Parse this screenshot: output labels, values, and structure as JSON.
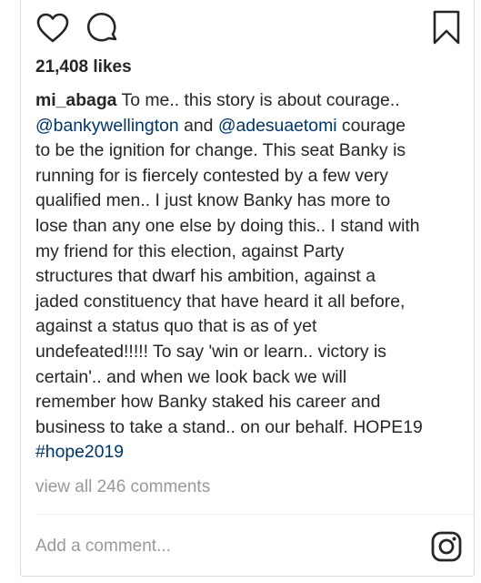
{
  "post": {
    "likes_text": "21,408 likes",
    "caption": {
      "username": "mi_abaga",
      "line1_text": "To me.. this story is about courage..",
      "mention1": "@bankywellington",
      "line2_and": "and",
      "mention2": "@adesuaetomi",
      "line2_rest": "courage",
      "line3": "to be the ignition for change. This seat Banky is",
      "line4": "running for is fiercely contested by a few very",
      "line5": "qualified men.. I just know Banky has more to",
      "line6": "lose than any one else by doing this.. I stand with",
      "line7": "my friend for this election, against Party",
      "line8": "structures that dwarf his ambition, against a",
      "line9": "jaded constituency that have heard it all before,",
      "line10": "against a status quo that is as of yet",
      "line11": "undefeated!!!!! To say 'win or learn.. victory is",
      "line12": "certain'.. and when we look back we will",
      "line13": "remember how Banky staked his career and",
      "line14": "business to take a stand.. on our behalf. HOPE19",
      "hashtag": "#hope2019"
    },
    "view_all_comments": "view all 246 comments",
    "add_comment_placeholder": "Add a comment..."
  },
  "icons": {
    "like": "heart-icon",
    "comment": "comment-icon",
    "save": "bookmark-icon",
    "open_app": "instagram-icon"
  },
  "colors": {
    "text": "#262626",
    "link": "#003569",
    "muted": "#999999",
    "border": "#dbdbdb"
  }
}
